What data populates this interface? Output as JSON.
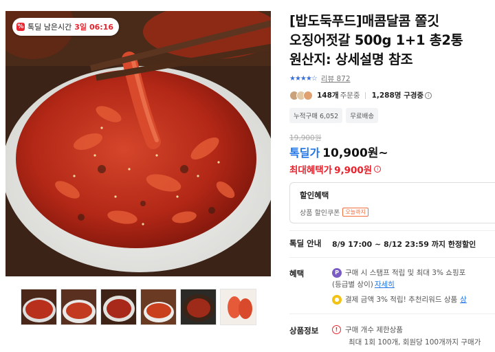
{
  "badge": {
    "label": "톡딜 남은시간",
    "days": "3일",
    "time": "06:16",
    "icon": "percent-icon"
  },
  "product": {
    "title_lines": [
      "[밥도둑푸드]매콤달콤 쫄깃",
      "오징어젓갈 500g 1+1 총2통",
      "원산지: 상세설명 참조"
    ],
    "rating_value": 4.5,
    "review_text": "리뷰 872"
  },
  "orders": {
    "count": "148개",
    "unit": "주문중",
    "subscribers": "1,288명 구경중"
  },
  "tags": [
    "누적구매 6,052",
    "무료배송"
  ],
  "price": {
    "original": "19,900원",
    "deal_label": "톡딜가",
    "deal_value": "10,900원~",
    "max_label": "최대혜택가",
    "max_value": "9,900원"
  },
  "coupon": {
    "heading": "할인혜택",
    "text": "상품 할인쿠폰",
    "today": "오늘까지"
  },
  "tokdeal": {
    "label": "톡딜 안내",
    "text": "8/9 17:00 ~ 8/12 23:59 까지 한정할인"
  },
  "benefit": {
    "label": "혜택",
    "line1": "구매 시 스탬프 적립 및 최대 3% 쇼핑포",
    "line1b": "(등급별 상이)",
    "detail_link": "자세히",
    "line2": "결제 금액 3% 적립! 추천리워드 상품",
    "line2_link": "상"
  },
  "product_info": {
    "label": "상품정보",
    "line1": "구매 개수 제한상품",
    "line2": "최대 1회 100개, 회원당 100개까지 구매가"
  },
  "colors": {
    "accent_blue": "#1f74e8",
    "accent_red": "#e9232d",
    "star": "#3b6fd6"
  }
}
